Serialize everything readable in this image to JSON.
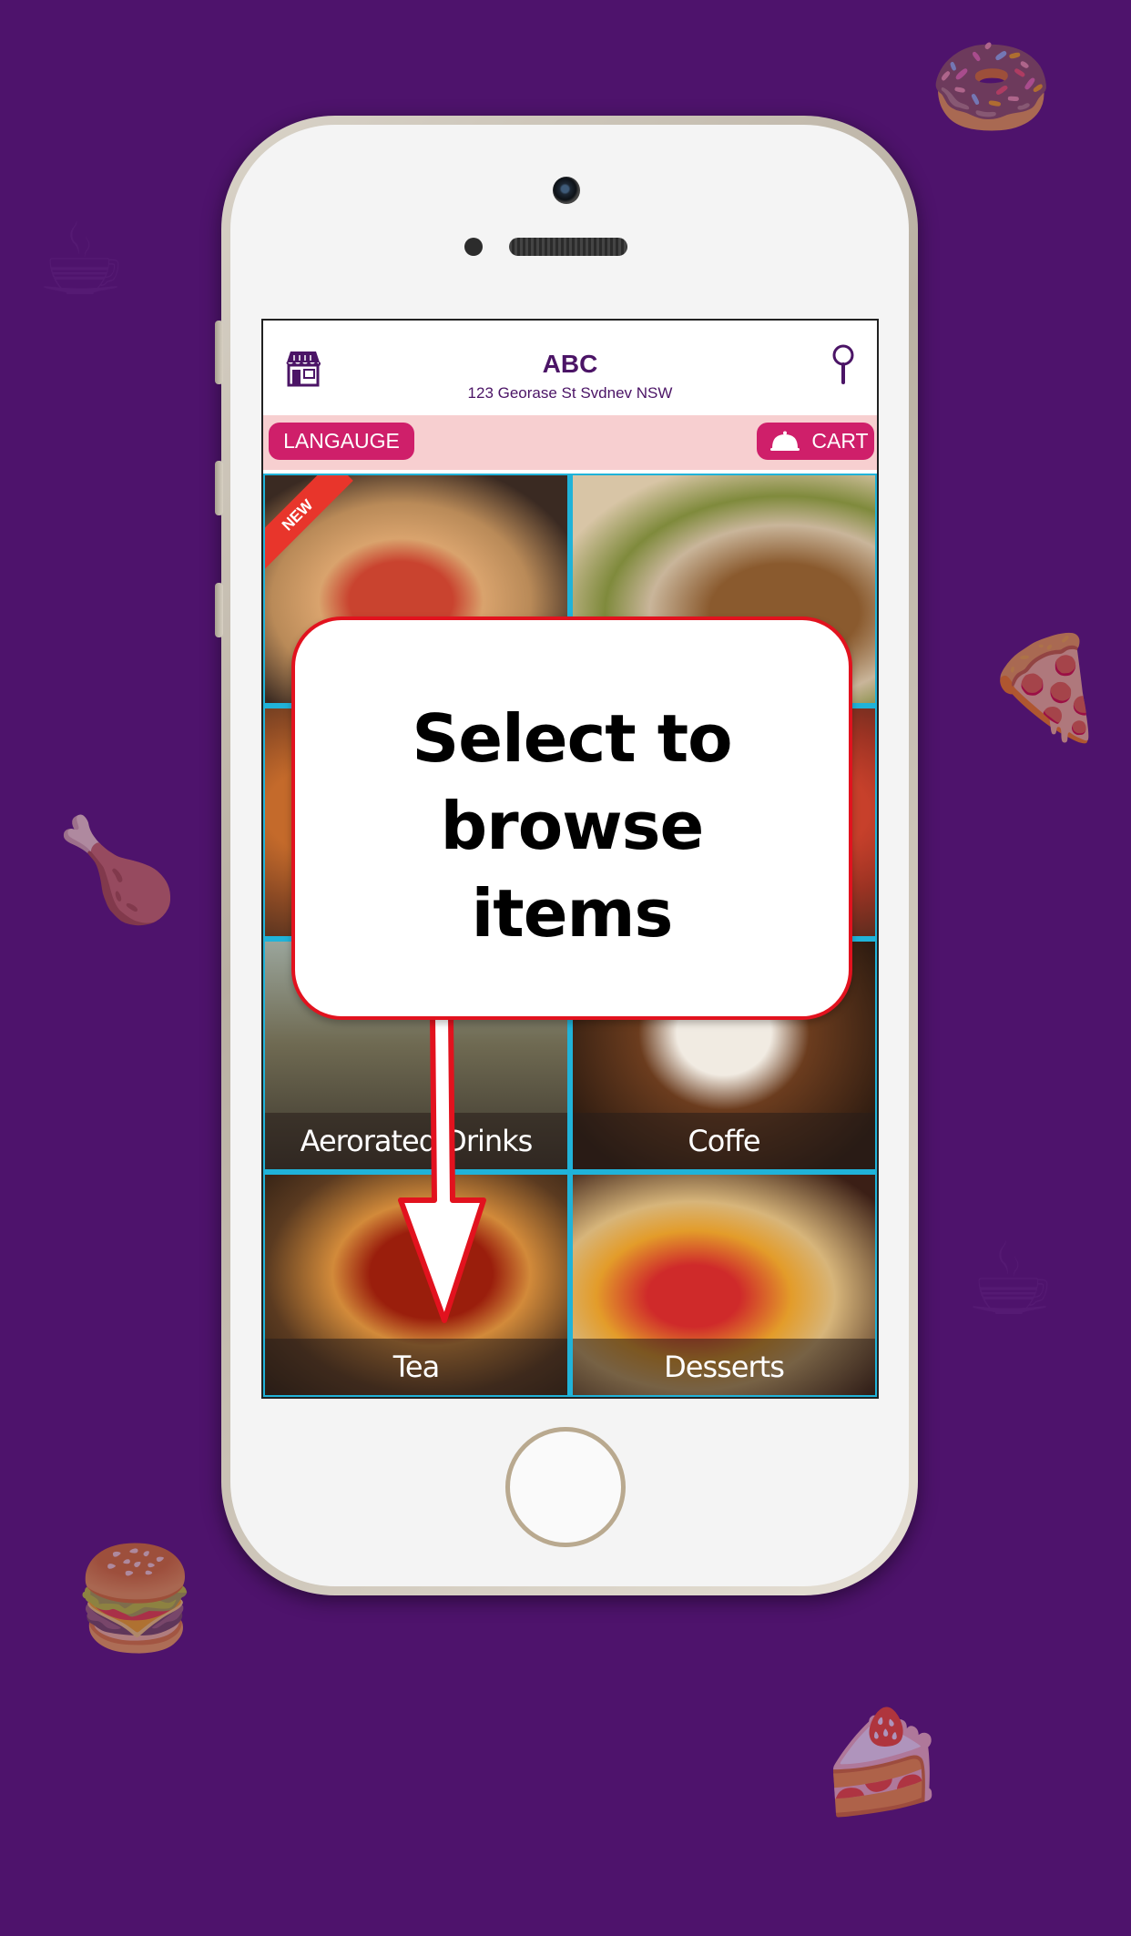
{
  "header": {
    "store_name": "ABC",
    "store_address": "123 Georase  St Svdnev NSW"
  },
  "toolbar": {
    "language_label": "LANGAUGE",
    "cart_label": "CART"
  },
  "categories": [
    {
      "label": "",
      "badge": "NEW",
      "photo": "antipasto-platter"
    },
    {
      "label": "",
      "photo": "bread-and-basil"
    },
    {
      "label": "",
      "photo": "fried-dish"
    },
    {
      "label": "",
      "photo": "pizza"
    },
    {
      "label": "Aerorated Drinks",
      "photo": "cocktails"
    },
    {
      "label": "Coffe",
      "photo": "coffee-cup"
    },
    {
      "label": "Tea",
      "photo": "tea-glass"
    },
    {
      "label": "Desserts",
      "photo": "fruit-tarts"
    }
  ],
  "callout": {
    "text": "Select to\nbrowse\nitems"
  },
  "colors": {
    "background": "#4e136c",
    "brand_purple": "#4b1466",
    "accent_pink": "#cf1f6a",
    "toolbar_bg": "#f7cfd0",
    "callout_border": "#e2121e"
  },
  "icons": [
    "store-icon",
    "search-icon",
    "bell-icon",
    "camera-icon",
    "home-button"
  ]
}
